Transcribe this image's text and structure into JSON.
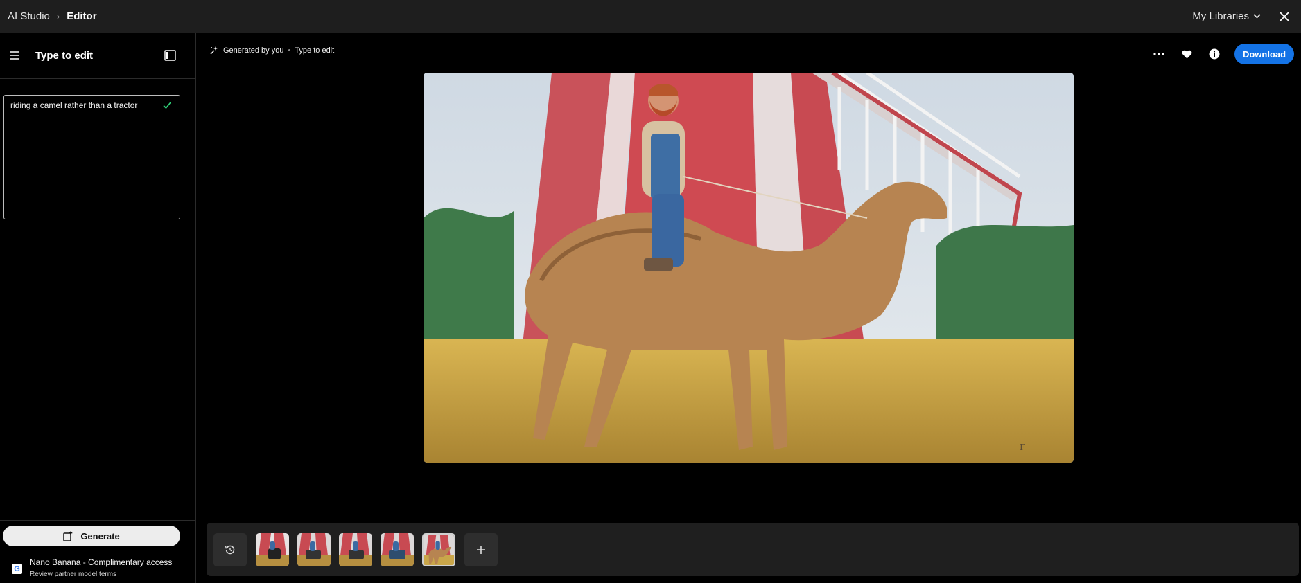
{
  "topbar": {
    "breadcrumb_root": "AI Studio",
    "breadcrumb_current": "Editor",
    "libraries_label": "My Libraries"
  },
  "sidebar": {
    "title": "Type to edit",
    "prompt_text": "riding a camel rather than a tractor",
    "generate_label": "Generate",
    "model_name": "Nano Banana - Complimentary access",
    "model_terms": "Review partner model terms",
    "partner_logo_letter": "G"
  },
  "main": {
    "generated_by": "Generated by you",
    "mode": "Type to edit",
    "download_label": "Download"
  },
  "filmstrip": {
    "thumbnails": [
      "variant-1",
      "variant-2",
      "variant-3",
      "variant-4",
      "variant-5"
    ],
    "selected_index": 4
  },
  "colors": {
    "accent": "#1473e6",
    "topbar_bg": "#1e1e1e",
    "filmstrip_bg": "#1f1f1f"
  }
}
